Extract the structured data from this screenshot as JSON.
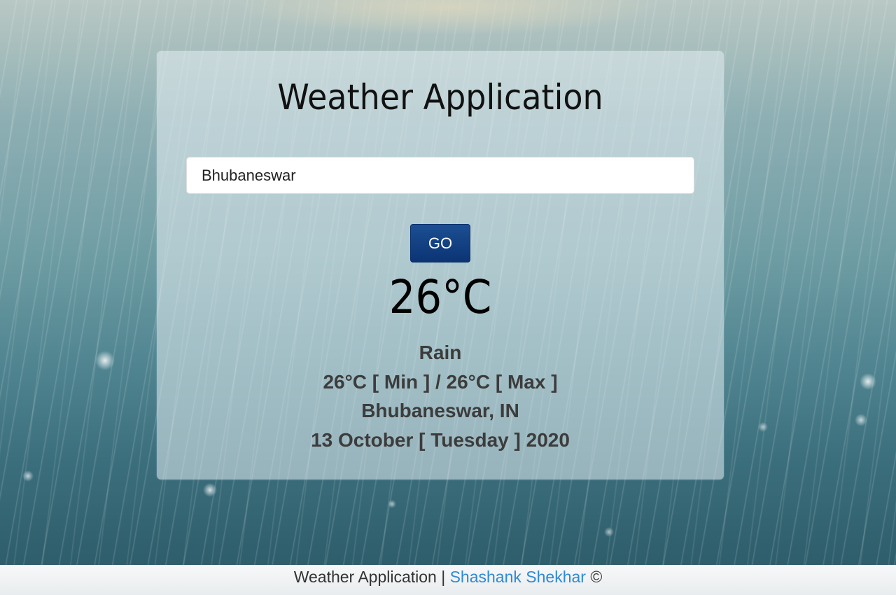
{
  "app": {
    "title": "Weather Application"
  },
  "search": {
    "value": "Bhubaneswar"
  },
  "go_button": {
    "label": "GO"
  },
  "weather": {
    "temperature": "26°C",
    "condition": "Rain",
    "min_max": "26°C [ Min ] / 26°C [ Max ]",
    "location": "Bhubaneswar, IN",
    "date": "13 October [ Tuesday ] 2020"
  },
  "footer": {
    "text": "Weather Application |",
    "author_link": "Shashank Shekhar",
    "copyright": "©"
  },
  "colors": {
    "button": "#0b3474",
    "link": "#2e8ad6",
    "info_text": "#3c3c3c"
  }
}
